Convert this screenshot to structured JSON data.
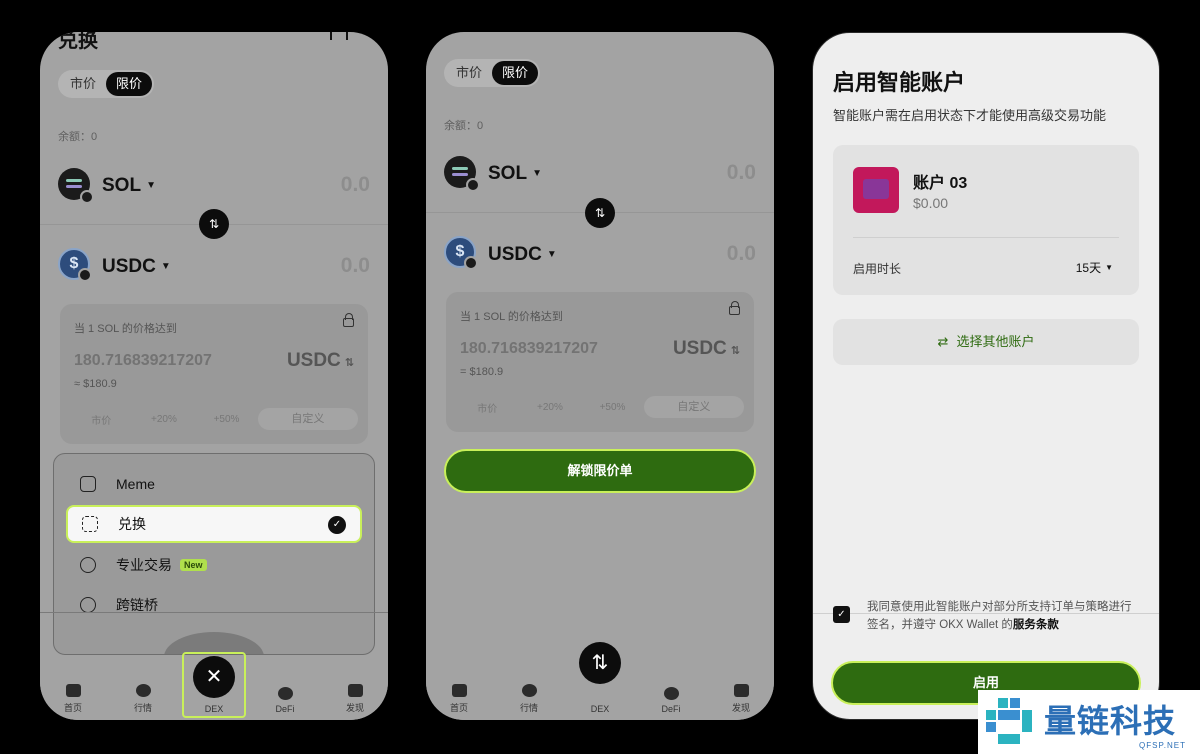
{
  "screen1": {
    "title": "兑换",
    "tabs": [
      {
        "label": "市价"
      },
      {
        "label": "限价"
      }
    ],
    "balance": "余额：0",
    "from": {
      "symbol": "SOL",
      "amount": "0.0"
    },
    "to": {
      "symbol": "USDC",
      "amount": "0.0"
    },
    "limit": {
      "label": "当 1 SOL 的价格达到",
      "price": "180.716839217207",
      "currency": "USDC",
      "usd": "≈ $180.9",
      "options": [
        "市价",
        "+20%",
        "+50%",
        "自定义"
      ]
    },
    "menu": [
      {
        "label": "Meme"
      },
      {
        "label": "兑换",
        "selected": true
      },
      {
        "label": "专业交易",
        "badge": "New"
      },
      {
        "label": "跨链桥"
      }
    ],
    "tabbar": [
      "首页",
      "行情",
      "DEX",
      "DeFi",
      "发现"
    ]
  },
  "screen2": {
    "tabs": [
      {
        "label": "市价"
      },
      {
        "label": "限价"
      }
    ],
    "balance": "余额：0",
    "from": {
      "symbol": "SOL",
      "amount": "0.0"
    },
    "to": {
      "symbol": "USDC",
      "amount": "0.0"
    },
    "limit": {
      "label": "当 1 SOL 的价格达到",
      "price": "180.716839217207",
      "currency": "USDC",
      "usd": "= $180.9",
      "options": [
        "市价",
        "+20%",
        "+50%",
        "自定义"
      ]
    },
    "unlock_button": "解锁限价单",
    "tabbar": [
      "首页",
      "行情",
      "DEX",
      "DeFi",
      "发现"
    ]
  },
  "screen3": {
    "title": "启用智能账户",
    "subtitle": "智能账户需在启用状态下才能使用高级交易功能",
    "account": {
      "name": "账户 03",
      "balance": "$0.00"
    },
    "duration_label": "启用时长",
    "duration_value": "15天",
    "other_account": "选择其他账户",
    "agree_text": "我同意使用此智能账户对部分所支持订单与策略进行签名，并遵守 OKX Wallet 的",
    "agree_link": "服务条款",
    "enable_button": "启用"
  },
  "watermark": {
    "title": "量链科技",
    "site": "QFSP.NET"
  },
  "colors": {
    "accent": "#c9f05a",
    "primary_green": "#2e6b10",
    "dark": "#0c0c0c"
  }
}
